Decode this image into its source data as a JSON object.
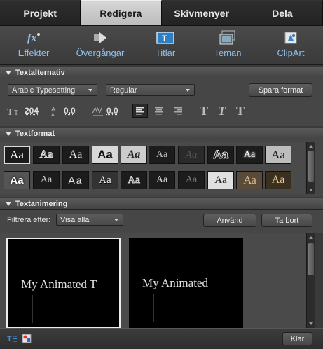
{
  "tabs": [
    {
      "label": "Projekt",
      "active": false
    },
    {
      "label": "Redigera",
      "active": true
    },
    {
      "label": "Skivmenyer",
      "active": false
    },
    {
      "label": "Dela",
      "active": false
    }
  ],
  "toolbar": {
    "items": [
      {
        "label": "Effekter",
        "icon": "fx-icon"
      },
      {
        "label": "Övergångar",
        "icon": "transition-arrow-icon"
      },
      {
        "label": "Titlar",
        "icon": "title-icon"
      },
      {
        "label": "Teman",
        "icon": "theme-icon"
      },
      {
        "label": "ClipArt",
        "icon": "clipart-icon"
      }
    ],
    "label_color": "#8fc0ee"
  },
  "text_options": {
    "header": "Textalternativ",
    "font": "Arabic Typesetting",
    "style": "Regular",
    "save_button": "Spara format",
    "size": "204",
    "leading": "0.0",
    "kerning": "0.0"
  },
  "text_format": {
    "header": "Textformat",
    "swatch_text": "Aa"
  },
  "text_animation": {
    "header": "Textanimering",
    "filter_label": "Filtrera efter:",
    "filter_value": "Visa alla",
    "apply_button": "Använd",
    "remove_button": "Ta bort",
    "items": [
      {
        "text": "My Animated T",
        "selected": true
      },
      {
        "text": "My Animated",
        "selected": false
      }
    ]
  },
  "footer": {
    "done_button": "Klar"
  }
}
